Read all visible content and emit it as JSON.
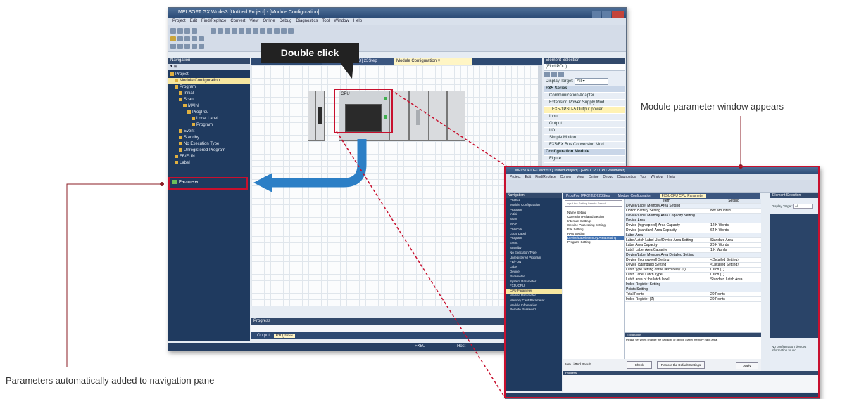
{
  "main_window": {
    "title": "MELSOFT GX Works3 [Untitled Project] - [Module Configuration]",
    "menu": [
      "Project",
      "Edit",
      "Find/Replace",
      "Convert",
      "View",
      "Online",
      "Debug",
      "Diagnostics",
      "Tool",
      "Window",
      "Help"
    ],
    "nav_header": "Navigation",
    "nav_items": [
      {
        "label": "Project",
        "level": 0
      },
      {
        "label": "Module Configuration",
        "level": 1,
        "selected": true
      },
      {
        "label": "Program",
        "level": 1
      },
      {
        "label": "Initial",
        "level": 2
      },
      {
        "label": "Scan",
        "level": 2
      },
      {
        "label": "MAIN",
        "level": 3
      },
      {
        "label": "ProgPou",
        "level": 4
      },
      {
        "label": "Local Label",
        "level": 5
      },
      {
        "label": "Program",
        "level": 5
      },
      {
        "label": "Event",
        "level": 2
      },
      {
        "label": "Standby",
        "level": 2
      },
      {
        "label": "No Execution Type",
        "level": 2
      },
      {
        "label": "Unregistered Program",
        "level": 2
      },
      {
        "label": "FB/FUN",
        "level": 1
      },
      {
        "label": "Label",
        "level": 1
      }
    ],
    "parameter_item": "Parameter",
    "tabs": [
      "ProgPou [PRG] [LD] 23Step",
      "Module Configuration"
    ],
    "element_selection": {
      "header": "Element Selection",
      "search": "(Find POU)",
      "display_target_label": "Display Target:",
      "display_target_value": "All",
      "items": [
        {
          "text": "FX5 Series",
          "type": "cat"
        },
        {
          "text": "Communication Adapter",
          "type": "sub"
        },
        {
          "text": "Extension Power Supply Mod",
          "type": "sub"
        },
        {
          "text": "FX5-1PSU-5 Output power",
          "type": "sel"
        },
        {
          "text": "Input",
          "type": "sub"
        },
        {
          "text": "Output",
          "type": "sub"
        },
        {
          "text": "I/O",
          "type": "sub"
        },
        {
          "text": "Simple Motion",
          "type": "sub"
        },
        {
          "text": "FX5/FX Bus Conversion Mod",
          "type": "sub"
        },
        {
          "text": "Configuration Module",
          "type": "cat"
        },
        {
          "text": "Figure",
          "type": "sub"
        }
      ]
    },
    "progress_header": "Progress",
    "bottom_tabs": [
      "Output",
      "Progress"
    ],
    "status": [
      "FX5U",
      "Host"
    ],
    "cpu_label": "CPU"
  },
  "second_window": {
    "title": "MELSOFT GX Works3 [Untitled Project] - [FX5UCPU CPU Parameter]",
    "tabs": [
      "ProgPou [PRG] [LD] 23Step",
      "Module Configuration",
      "FX5UCPU CPU Parameter"
    ],
    "search_placeholder": "Input the Setting Item to Search",
    "tree_items": [
      "Name Setting",
      "Operation Related Setting",
      "Interrupt Settings",
      "Service Processing Setting",
      "File Setting",
      "RAS Setting",
      "Device/Label Memory Area Setting",
      "Program Setting"
    ],
    "grid_header": [
      "Item",
      "Setting"
    ],
    "grid_rows": [
      [
        "Device/Label Memory Area Setting",
        ""
      ],
      [
        "Option Battery Setting",
        "Not Mounted"
      ],
      [
        "Device/Label Memory Area Capacity Setting",
        ""
      ],
      [
        "Device Area",
        ""
      ],
      [
        "Device (high speed) Area Capacity",
        "12 K Words"
      ],
      [
        "Device (standard) Area Capacity",
        "64 K Words"
      ],
      [
        "Label Area",
        ""
      ],
      [
        "Label/Latch Label Use/Device Area Setting",
        "Standard Area"
      ],
      [
        "Label Area Capacity",
        "20 K Words"
      ],
      [
        "Latch Label Area Capacity",
        "1 K Words"
      ],
      [
        "Device/Label Memory Area Detailed Setting",
        ""
      ],
      [
        "Device (high speed) Setting",
        "<Detailed Setting>"
      ],
      [
        "Device (Standard) Setting",
        "<Detailed Setting>"
      ],
      [
        "Latch type setting of the latch relay (L)",
        "Latch (1)"
      ],
      [
        "Latch Label Latch Type",
        "Latch (1)"
      ],
      [
        "Latch area of the latch label",
        "Standard Latch Area"
      ],
      [
        "Index Register Setting",
        ""
      ],
      [
        "Points Setting",
        ""
      ],
      [
        "Total Points",
        "20 Points"
      ],
      [
        "Index Register (Z)",
        "20 Points"
      ]
    ],
    "explanation_header": "Explanation",
    "explanation_text": "Please set when change the capacity of device / label memory each area.",
    "buttons": [
      "Check",
      "Restore the Default Settings",
      "Apply"
    ],
    "item_list_labels": [
      "Item List",
      "Find Result"
    ],
    "element_selection_header": "Element Selection",
    "display_target_label": "Display Target:",
    "display_target_value": "All",
    "module_config_message": "No configuration devices information found.",
    "progress_header": "Progress",
    "nav_items": [
      "Project",
      "Module Configuration",
      "Program",
      "Initial",
      "Scan",
      "MAIN",
      "ProgPou",
      "Local Label",
      "Program",
      "Event",
      "Standby",
      "No Execution Type",
      "Unregistered Program",
      "FB/FUN",
      "Label",
      "Device",
      "Parameter",
      "System Parameter",
      "FX5UCPU",
      "CPU Parameter",
      "Module Parameter",
      "Memory Card Parameter",
      "Module Information",
      "Remote Password"
    ]
  },
  "callouts": {
    "double_click": "Double click",
    "module_param_window": "Module parameter window appears",
    "params_added": "Parameters automatically added to navigation pane"
  },
  "colors": {
    "highlight_red": "#c8102e",
    "arrow_blue": "#2c7fc6",
    "callout_bg": "#222222",
    "leader_line": "#8b1c24"
  }
}
